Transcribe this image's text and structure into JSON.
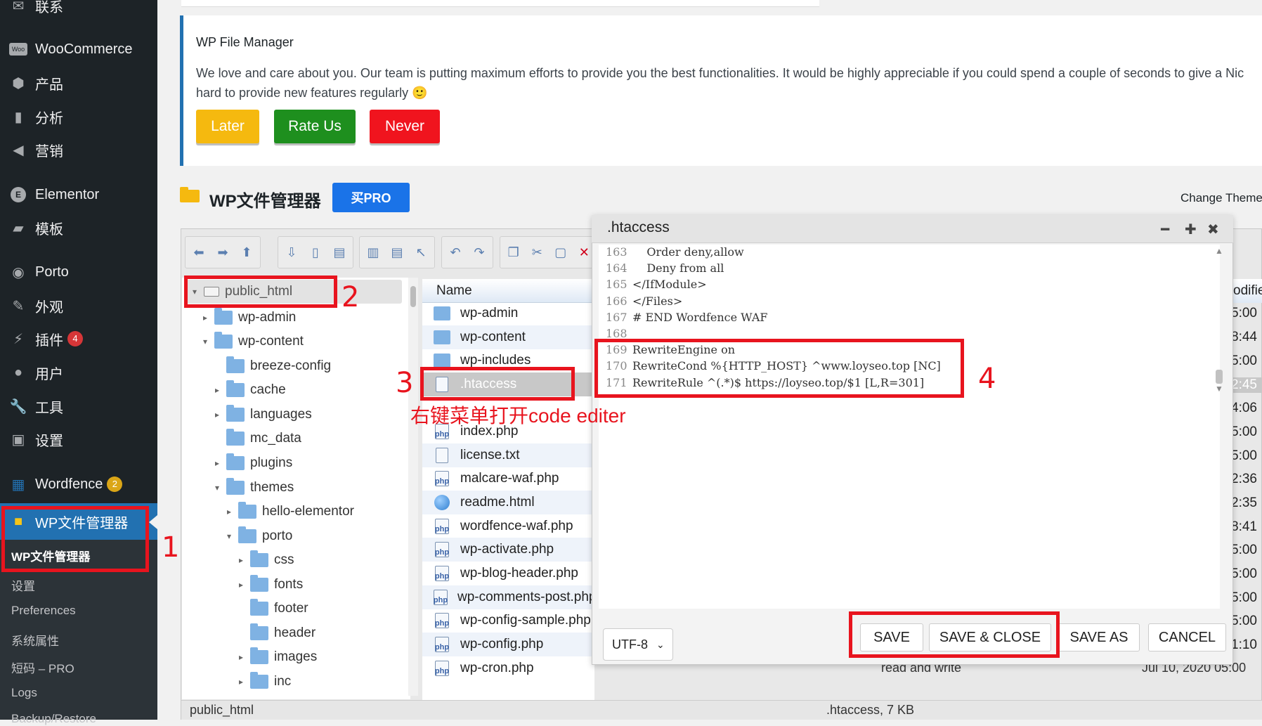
{
  "sidebar": {
    "items": [
      {
        "label": "联系",
        "icon": "mail-icon"
      },
      {
        "label": "WooCommerce",
        "icon": "woo-icon"
      },
      {
        "label": "产品",
        "icon": "box-icon"
      },
      {
        "label": "分析",
        "icon": "bar-chart-icon"
      },
      {
        "label": "营销",
        "icon": "megaphone-icon"
      },
      {
        "label": "Elementor",
        "icon": "elementor-icon"
      },
      {
        "label": "模板",
        "icon": "folder-open-icon"
      },
      {
        "label": "Porto",
        "icon": "porto-icon"
      },
      {
        "label": "外观",
        "icon": "brush-icon"
      },
      {
        "label": "插件",
        "icon": "plug-icon",
        "badge": "4"
      },
      {
        "label": "用户",
        "icon": "user-icon"
      },
      {
        "label": "工具",
        "icon": "wrench-icon"
      },
      {
        "label": "设置",
        "icon": "settings-icon"
      },
      {
        "label": "Wordfence",
        "icon": "wordfence-icon",
        "badge": "2"
      },
      {
        "label": "WP文件管理器",
        "icon": "folder-icon"
      }
    ],
    "submenu": [
      "WP文件管理器",
      "设置",
      "Preferences",
      "系统属性",
      "短码 – PRO",
      "Logs",
      "Backup/Restore"
    ]
  },
  "notice": {
    "title": "WP File Manager",
    "message": "We love and care about you. Our team is putting maximum efforts to provide you the best functionalities. It would be highly appreciable if you could spend a couple of seconds to give a Nic",
    "message2": "hard to provide new features regularly 🙂",
    "later": "Later",
    "rate": "Rate Us",
    "never": "Never"
  },
  "header": {
    "title": "WP文件管理器",
    "pro": "买PRO",
    "change_theme": "Change Theme"
  },
  "tree": [
    {
      "label": "public_html",
      "level": 0,
      "arrow": "▾"
    },
    {
      "label": "wp-admin",
      "level": 1,
      "arrow": "▸"
    },
    {
      "label": "wp-content",
      "level": 1,
      "arrow": "▾"
    },
    {
      "label": "breeze-config",
      "level": 2,
      "arrow": ""
    },
    {
      "label": "cache",
      "level": 2,
      "arrow": "▸"
    },
    {
      "label": "languages",
      "level": 2,
      "arrow": "▸"
    },
    {
      "label": "mc_data",
      "level": 2,
      "arrow": ""
    },
    {
      "label": "plugins",
      "level": 2,
      "arrow": "▸"
    },
    {
      "label": "themes",
      "level": 2,
      "arrow": "▾"
    },
    {
      "label": "hello-elementor",
      "level": 3,
      "arrow": "▸"
    },
    {
      "label": "porto",
      "level": 3,
      "arrow": "▾"
    },
    {
      "label": "css",
      "level": 4,
      "arrow": "▸"
    },
    {
      "label": "fonts",
      "level": 4,
      "arrow": "▸"
    },
    {
      "label": "footer",
      "level": 4,
      "arrow": ""
    },
    {
      "label": "header",
      "level": 4,
      "arrow": ""
    },
    {
      "label": "images",
      "level": 4,
      "arrow": "▸"
    },
    {
      "label": "inc",
      "level": 4,
      "arrow": "▸"
    }
  ],
  "filelist": {
    "column_name": "Name",
    "column_modified": "odifie",
    "files": [
      {
        "name": "wp-admin",
        "type": "folder",
        "time": "5:00"
      },
      {
        "name": "wp-content",
        "type": "folder",
        "time": "8:44"
      },
      {
        "name": "wp-includes",
        "type": "folder",
        "time": "5:00"
      },
      {
        "name": ".htaccess",
        "type": "doc",
        "time": "2:45"
      },
      {
        "name": "",
        "type": "blank",
        "time": "4:06"
      },
      {
        "name": "index.php",
        "type": "php",
        "time": "5:00"
      },
      {
        "name": "license.txt",
        "type": "doc",
        "time": "5:00"
      },
      {
        "name": "malcare-waf.php",
        "type": "php",
        "time": "2:36"
      },
      {
        "name": "readme.html",
        "type": "globe",
        "time": "2:35"
      },
      {
        "name": "wordfence-waf.php",
        "type": "php",
        "time": "8:41"
      },
      {
        "name": "wp-activate.php",
        "type": "php",
        "time": "5:00"
      },
      {
        "name": "wp-blog-header.php",
        "type": "php",
        "time": "5:00"
      },
      {
        "name": "wp-comments-post.php",
        "type": "php",
        "time": "5:00"
      },
      {
        "name": "wp-config-sample.php",
        "type": "php",
        "time": "5:00"
      },
      {
        "name": "wp-config.php",
        "type": "php",
        "time": "1:10"
      },
      {
        "name": "wp-cron.php",
        "type": "php",
        "time": ""
      }
    ],
    "cron_perm": "read and write",
    "cron_date": "Jul 10, 2020 05:00"
  },
  "editor": {
    "title": ".htaccess",
    "lines": [
      {
        "n": "163",
        "t": "    Order deny,allow"
      },
      {
        "n": "164",
        "t": "    Deny from all"
      },
      {
        "n": "165",
        "t": "</IfModule>"
      },
      {
        "n": "166",
        "t": "</Files>"
      },
      {
        "n": "167",
        "t": "# END Wordfence WAF"
      },
      {
        "n": "168",
        "t": ""
      },
      {
        "n": "169",
        "t": "RewriteEngine on"
      },
      {
        "n": "170",
        "t": "RewriteCond %{HTTP_HOST} ^www.loyseo.top [NC]"
      },
      {
        "n": "171",
        "t": "RewriteRule ^(.*)$ https://loyseo.top/$1 [L,R=301]"
      }
    ],
    "encoding": "UTF-8",
    "save": "SAVE",
    "save_close": "SAVE & CLOSE",
    "save_as": "SAVE AS",
    "cancel": "CANCEL"
  },
  "status": {
    "path": "public_html",
    "selection": ".htaccess, 7 KB"
  },
  "annotations": {
    "n1": "1",
    "n2": "2",
    "n3": "3",
    "n4": "4",
    "hint": "右键菜单打开code editer"
  },
  "colors": {
    "sidebar_bg": "#1d2327",
    "active": "#2271b1",
    "later": "#f5b90f",
    "rate": "#1e8f1e",
    "never": "#f0141e",
    "annotation": "#e8141e"
  }
}
